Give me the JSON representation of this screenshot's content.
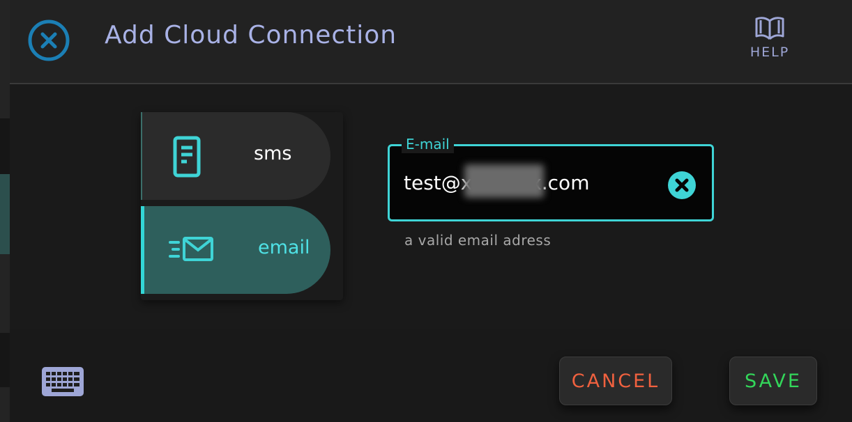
{
  "dialog": {
    "title": "Add Cloud Connection",
    "close_icon": "close-circle-icon",
    "help": {
      "label": "HELP",
      "icon": "book-icon"
    }
  },
  "menu": {
    "items": [
      {
        "label": "sms",
        "icon": "phone-document-icon",
        "selected": false
      },
      {
        "label": "email",
        "icon": "email-fast-icon",
        "selected": true
      }
    ]
  },
  "email_field": {
    "label": "E-mail",
    "value": "test@xxxxxxx.com",
    "hint": "a valid email adress",
    "clear_icon": "clear-circle-icon"
  },
  "footer": {
    "keyboard_icon": "keyboard-icon",
    "cancel_label": "CANCEL",
    "save_label": "SAVE"
  },
  "colors": {
    "accent": "#3fd4d6",
    "title": "#a9b2e6",
    "cancel": "#f0613f",
    "save": "#33d65a",
    "selected_item_bg": "#2e5f5c"
  }
}
